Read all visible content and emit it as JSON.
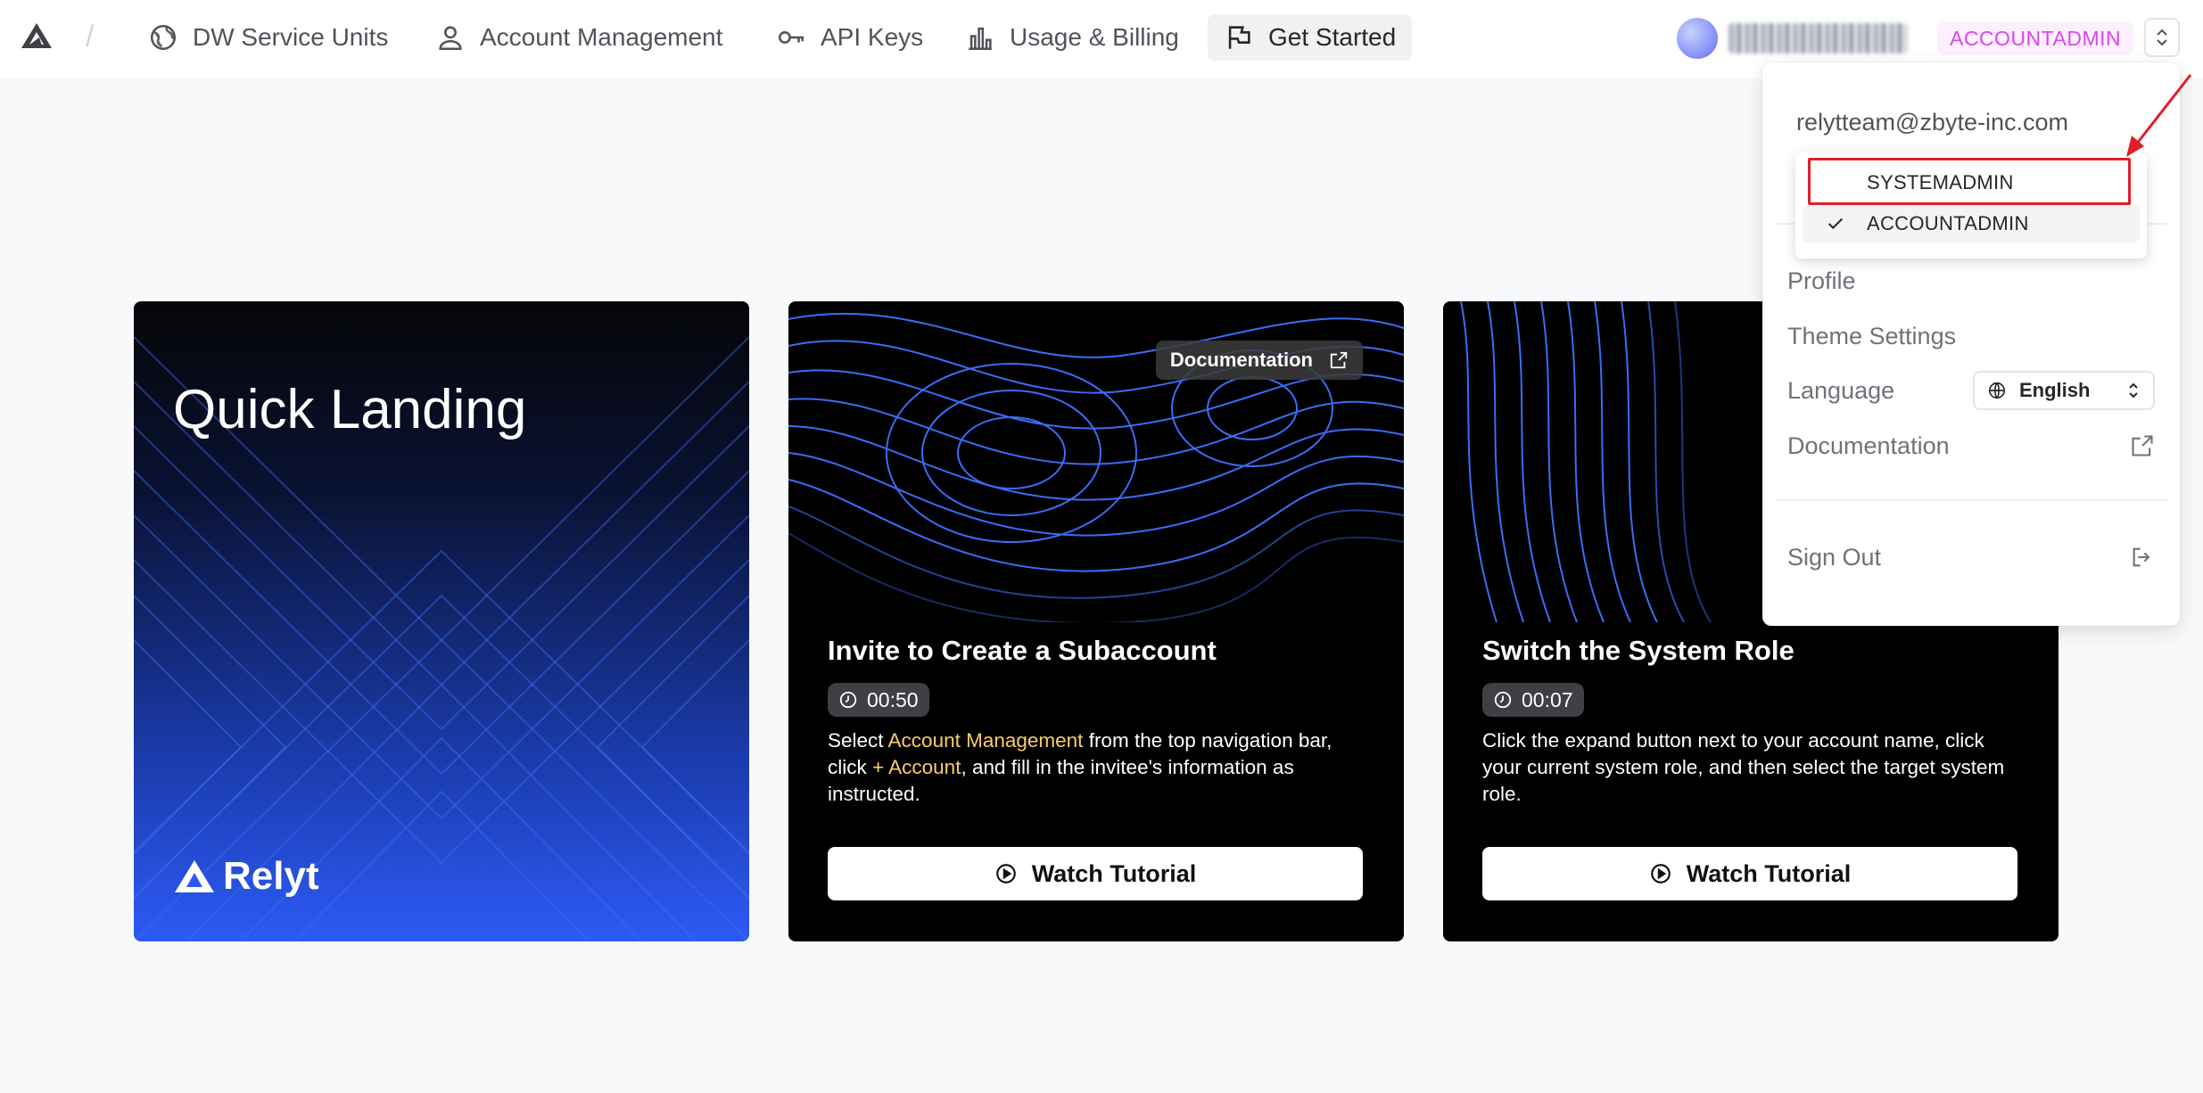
{
  "nav": {
    "items": [
      {
        "label": "DW Service Units",
        "icon": "globe-icon"
      },
      {
        "label": "Account Management",
        "icon": "user-icon"
      },
      {
        "label": "API Keys",
        "icon": "key-icon"
      },
      {
        "label": "Usage & Billing",
        "icon": "bar-chart-icon"
      },
      {
        "label": "Get Started",
        "icon": "flag-icon"
      }
    ],
    "separator": "/",
    "current_role": "ACCOUNTADMIN"
  },
  "cards": {
    "landing": {
      "title": "Quick Landing",
      "brand": "Relyt"
    },
    "invite": {
      "doc_label": "Documentation",
      "title": "Invite to Create a Subaccount",
      "duration": "00:50",
      "desc_1": "Select ",
      "desc_hl_1": "Account Management",
      "desc_2": " from the top navigation bar, click ",
      "desc_hl_2": "+ Account",
      "desc_3": ", and fill in the invitee's information as instructed.",
      "button": "Watch Tutorial"
    },
    "switch": {
      "title": "Switch the System Role",
      "duration": "00:07",
      "desc": "Click the expand button next to your account name, click your current system role, and then select the target system role.",
      "button": "Watch Tutorial"
    }
  },
  "menu": {
    "email": "relytteam@zbyte-inc.com",
    "roles": [
      "SYSTEMADMIN",
      "ACCOUNTADMIN"
    ],
    "selected_role": "ACCOUNTADMIN",
    "profile": "Profile",
    "theme": "Theme Settings",
    "language_label": "Language",
    "language_value": "English",
    "documentation": "Documentation",
    "sign_out": "Sign Out"
  },
  "colors": {
    "role_badge": "#d946ef",
    "highlight_text": "#facc6b",
    "annotation": "#e11d2a",
    "accent_blue": "#2d5af5"
  }
}
